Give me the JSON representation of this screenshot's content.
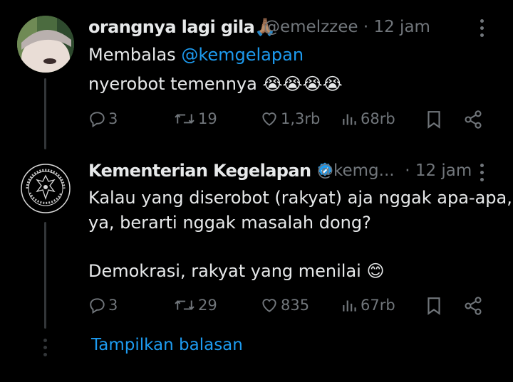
{
  "tweet1": {
    "name": "orangnya lagi gila",
    "name_emoji": "🙏🏽",
    "handle": "@emelzzee",
    "time": "· 12 jam",
    "reply_prefix": "Membalas",
    "reply_to": "@kemgelapan",
    "text": "nyerobot temennya",
    "text_emoji": "😭😭😭😭",
    "replies": "3",
    "retweets": "19",
    "likes": "1,3rb",
    "views": "68rb"
  },
  "tweet2": {
    "name": "Kementerian Kegelapan",
    "handle": "@kemg...",
    "time": "· 12 jam",
    "line1": "Kalau yang diserobot (rakyat) aja nggak apa-apa,",
    "line2": "ya, berarti nggak masalah dong?",
    "line3": "Demokrasi, rakyat yang menilai",
    "line3_emoji": "😊",
    "replies": "3",
    "retweets": "29",
    "likes": "835",
    "views": "67rb",
    "logo_text": "KEMENTERIAN KEGELAPAN REPUBLIK INDONESIA"
  },
  "show_replies": "Tampilkan balasan",
  "colors": {
    "background": "#000000",
    "accent": "#1d9bf0",
    "muted": "#71767b",
    "verified": "#1d9bf0"
  }
}
